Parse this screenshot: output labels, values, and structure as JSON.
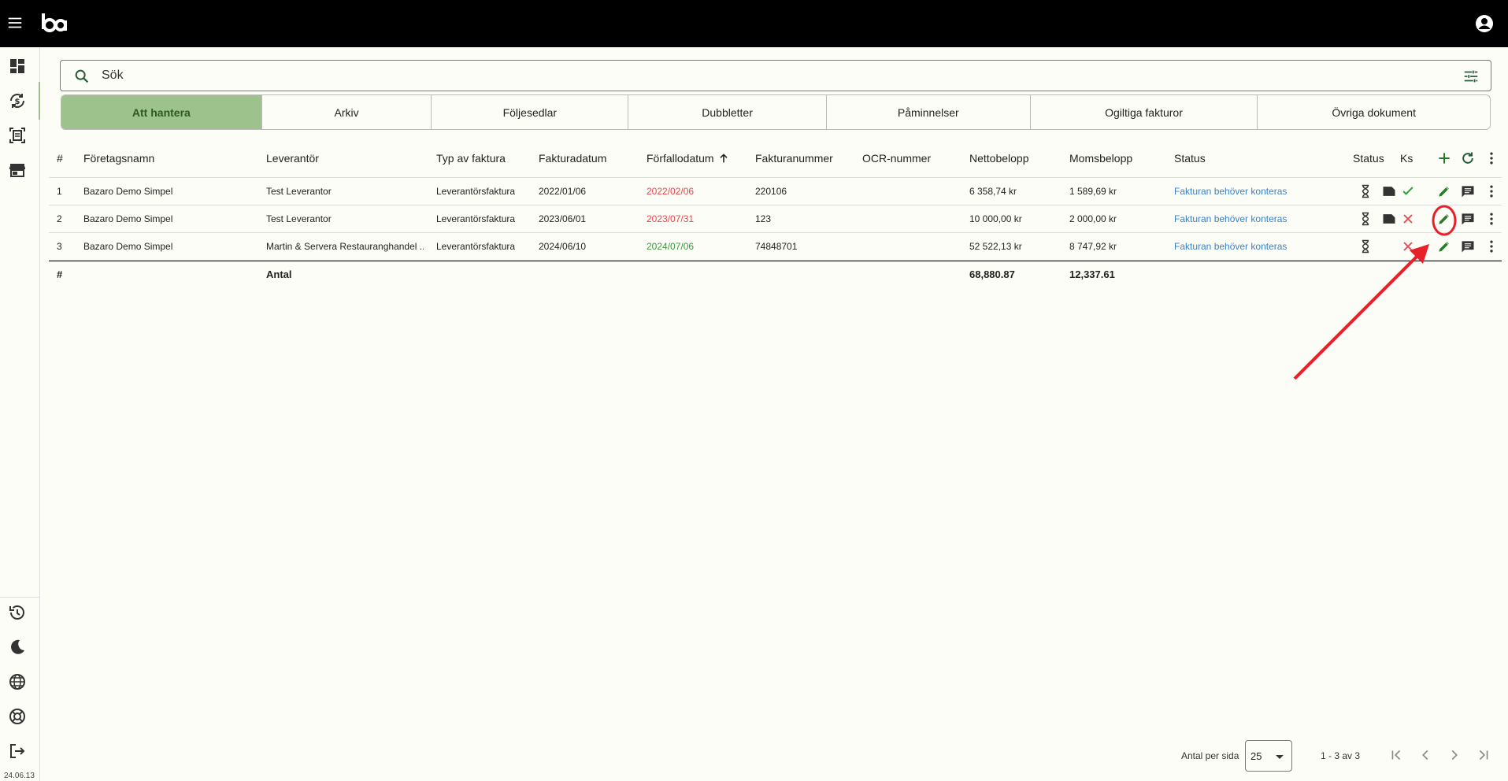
{
  "app": {
    "version": "24.06.13"
  },
  "search": {
    "placeholder": "Sök"
  },
  "tabs": [
    {
      "label": "Att hantera",
      "active": true
    },
    {
      "label": "Arkiv"
    },
    {
      "label": "Följesedlar"
    },
    {
      "label": "Dubbletter"
    },
    {
      "label": "Påminnelser"
    },
    {
      "label": "Ogiltiga fakturor"
    },
    {
      "label": "Övriga dokument"
    }
  ],
  "table": {
    "headers": {
      "num": "#",
      "company": "Företagsnamn",
      "supplier": "Leverantör",
      "type": "Typ av faktura",
      "invoice_date": "Fakturadatum",
      "due_date": "Förfallodatum",
      "invoice_no": "Fakturanummer",
      "ocr": "OCR-nummer",
      "net": "Nettobelopp",
      "vat": "Momsbelopp",
      "status": "Status",
      "status2": "Status",
      "ks": "Ks"
    },
    "rows": [
      {
        "num": "1",
        "company": "Bazaro Demo Simpel",
        "supplier": "Test Leverantor",
        "type": "Leverantörsfaktura",
        "invoice_date": "2022/01/06",
        "due_date": "2022/02/06",
        "due_state": "overdue",
        "invoice_no": "220106",
        "ocr": "",
        "net": "6 358,74 kr",
        "vat": "1 589,69 kr",
        "status": "Fakturan behöver konteras",
        "ks": "check"
      },
      {
        "num": "2",
        "company": "Bazaro Demo Simpel",
        "supplier": "Test Leverantor",
        "type": "Leverantörsfaktura",
        "invoice_date": "2023/06/01",
        "due_date": "2023/07/31",
        "due_state": "overdue",
        "invoice_no": "123",
        "ocr": "",
        "net": "10 000,00 kr",
        "vat": "2 000,00 kr",
        "status": "Fakturan behöver konteras",
        "ks": "cross"
      },
      {
        "num": "3",
        "company": "Bazaro Demo Simpel",
        "supplier": "Martin & Servera Restauranghandel ...",
        "type": "Leverantörsfaktura",
        "invoice_date": "2024/06/10",
        "due_date": "2024/07/06",
        "due_state": "ok",
        "invoice_no": "74848701",
        "ocr": "",
        "net": "52 522,13 kr",
        "vat": "8 747,92 kr",
        "status": "Fakturan behöver konteras",
        "ks": "cross"
      }
    ],
    "footer": {
      "num": "#",
      "label": "Antal",
      "net_total": "68,880.87",
      "vat_total": "12,337.61"
    }
  },
  "pagination": {
    "per_page_label": "Antal per sida",
    "per_page_value": "25",
    "range": "1 - 3 av 3"
  },
  "colors": {
    "accent": "#9ec28c",
    "overdue": "#e5484d",
    "ok": "#3b9a3b",
    "link": "#3b82c4",
    "annotation": "#e8202a"
  }
}
